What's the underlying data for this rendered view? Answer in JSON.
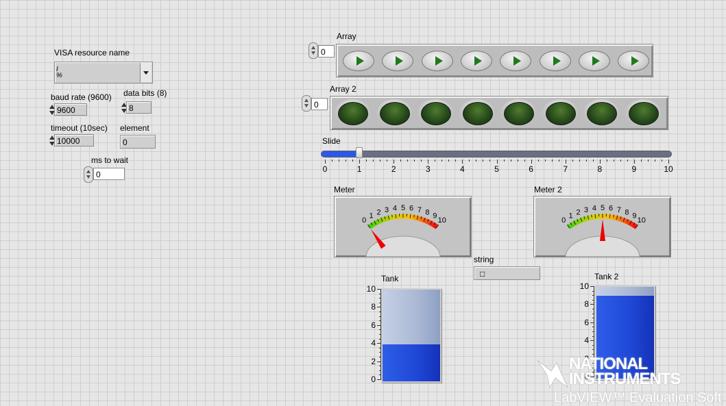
{
  "visa": {
    "label": "VISA resource name",
    "value": "",
    "icon": "visa-io-icon"
  },
  "baud": {
    "label": "baud rate (9600)",
    "value": "9600"
  },
  "databits": {
    "label": "data bits (8)",
    "value": "8"
  },
  "timeout": {
    "label": "timeout (10sec)",
    "value": "10000"
  },
  "element": {
    "label": "element",
    "value": "0"
  },
  "mswait": {
    "label": "ms to wait",
    "value": "0"
  },
  "array1": {
    "label": "Array",
    "index": "0",
    "count": 8,
    "item_icon": "play-arrow-icon"
  },
  "array2": {
    "label": "Array 2",
    "index": "0",
    "count": 8
  },
  "slide": {
    "label": "Slide",
    "value": 1,
    "min": 0,
    "max": 10,
    "ticks": [
      "0",
      "1",
      "2",
      "3",
      "4",
      "5",
      "6",
      "7",
      "8",
      "9",
      "10"
    ],
    "fill_color": "#2b58e8"
  },
  "meter1": {
    "label": "Meter",
    "value": 0,
    "ticks": [
      "0",
      "1",
      "2",
      "3",
      "4",
      "5",
      "6",
      "7",
      "8",
      "9",
      "10"
    ]
  },
  "meter2": {
    "label": "Meter 2",
    "value": 5,
    "ticks": [
      "0",
      "1",
      "2",
      "3",
      "4",
      "5",
      "6",
      "7",
      "8",
      "9",
      "10"
    ]
  },
  "string": {
    "label": "string",
    "value": "□"
  },
  "tank1": {
    "label": "Tank",
    "value": 4,
    "max": 10,
    "ticks": [
      "10",
      "8",
      "6",
      "4",
      "2",
      "0"
    ]
  },
  "tank2": {
    "label": "Tank 2",
    "value": 9,
    "max": 10,
    "ticks": [
      "10",
      "8",
      "6",
      "4",
      "2",
      "0"
    ]
  },
  "watermark": {
    "line1": "NATIONAL",
    "line2": "INSTRUMENTS",
    "line3": "LabVIEW™ Evaluation Soft"
  },
  "colors": {
    "background": "#e6e6e6",
    "grid": "#cfcfcf",
    "fill_blue": "#1f47d6",
    "led_off": "#24461a"
  }
}
